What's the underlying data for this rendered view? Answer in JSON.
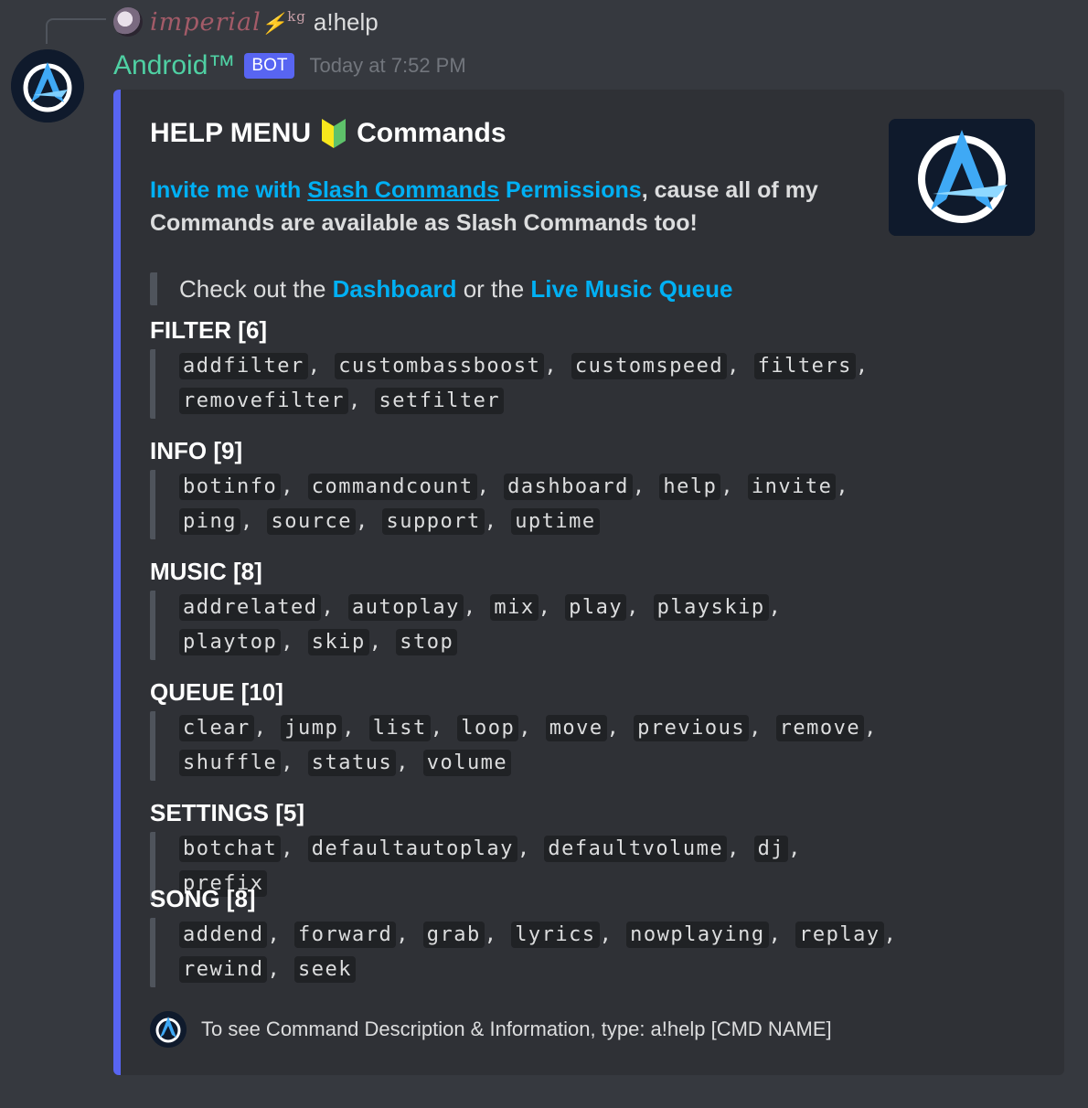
{
  "reply": {
    "username": "imperial",
    "username_suffix": "kg",
    "text": "a!help"
  },
  "message": {
    "username": "Android™",
    "bot_tag": "BOT",
    "timestamp": "Today at 7:52 PM"
  },
  "embed": {
    "title_left": "HELP MENU",
    "title_right": "Commands",
    "desc_link_1": "Invite me with ",
    "desc_link_2": "Slash Commands",
    "desc_link_3": " Permissions",
    "desc_rest": ", cause all of my Commands are available as Slash Commands too!",
    "quote_prefix": "Check out the ",
    "quote_link_1": "Dashboard",
    "quote_mid": " or the ",
    "quote_link_2": "Live Music Queue",
    "fields": [
      {
        "name": "FILTER [6]",
        "commands": [
          "addfilter",
          "custombassboost",
          "customspeed",
          "filters",
          "removefilter",
          "setfilter"
        ]
      },
      {
        "name": "INFO [9]",
        "commands": [
          "botinfo",
          "commandcount",
          "dashboard",
          "help",
          "invite",
          "ping",
          "source",
          "support",
          "uptime"
        ]
      },
      {
        "name": "MUSIC [8]",
        "commands": [
          "addrelated",
          "autoplay",
          "mix",
          "play",
          "playskip",
          "playtop",
          "skip",
          "stop"
        ]
      },
      {
        "name": "QUEUE [10]",
        "commands": [
          "clear",
          "jump",
          "list",
          "loop",
          "move",
          "previous",
          "remove",
          "shuffle",
          "status",
          "volume"
        ]
      },
      {
        "name": "SETTINGS [5]",
        "commands": [
          "botchat",
          "defaultautoplay",
          "defaultvolume",
          "dj",
          "prefix"
        ]
      },
      {
        "name": "SONG [8]",
        "commands": [
          "addend",
          "forward",
          "grab",
          "lyrics",
          "nowplaying",
          "replay",
          "rewind",
          "seek"
        ]
      }
    ],
    "footer": "To see Command Description & Information, type: a!help [CMD NAME]"
  },
  "colors": {
    "background": "#36393f",
    "embed_bg": "#2f3136",
    "embed_accent": "#5865f2",
    "link": "#00b0f4",
    "username": "#4fd0a3",
    "code_bg": "#202225"
  },
  "icons": [
    "bot-logo-icon",
    "beginner-badge-icon",
    "lightning-icon"
  ]
}
